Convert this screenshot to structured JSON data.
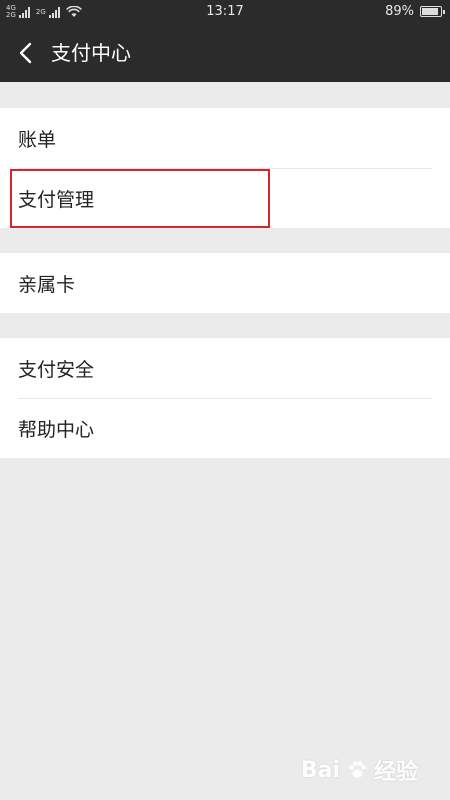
{
  "status_bar": {
    "network_top": "4G",
    "network_bottom": "2G",
    "network2_top": "2G",
    "network2_bottom": "",
    "time": "13:17",
    "battery": "89%",
    "battery_level": 0.89
  },
  "header": {
    "title": "支付中心",
    "back_icon": "chevron-left-icon"
  },
  "groups": [
    {
      "items": [
        {
          "label": "账单"
        },
        {
          "label": "支付管理"
        }
      ]
    },
    {
      "items": [
        {
          "label": "亲属卡"
        }
      ]
    },
    {
      "items": [
        {
          "label": "支付安全"
        },
        {
          "label": "帮助中心"
        }
      ]
    }
  ],
  "watermark": {
    "brand": "Bai",
    "brand_suffix": "经验"
  },
  "colors": {
    "header_bg": "#2b2b2b",
    "page_bg": "#ebebeb",
    "highlight": "#d5262b"
  }
}
